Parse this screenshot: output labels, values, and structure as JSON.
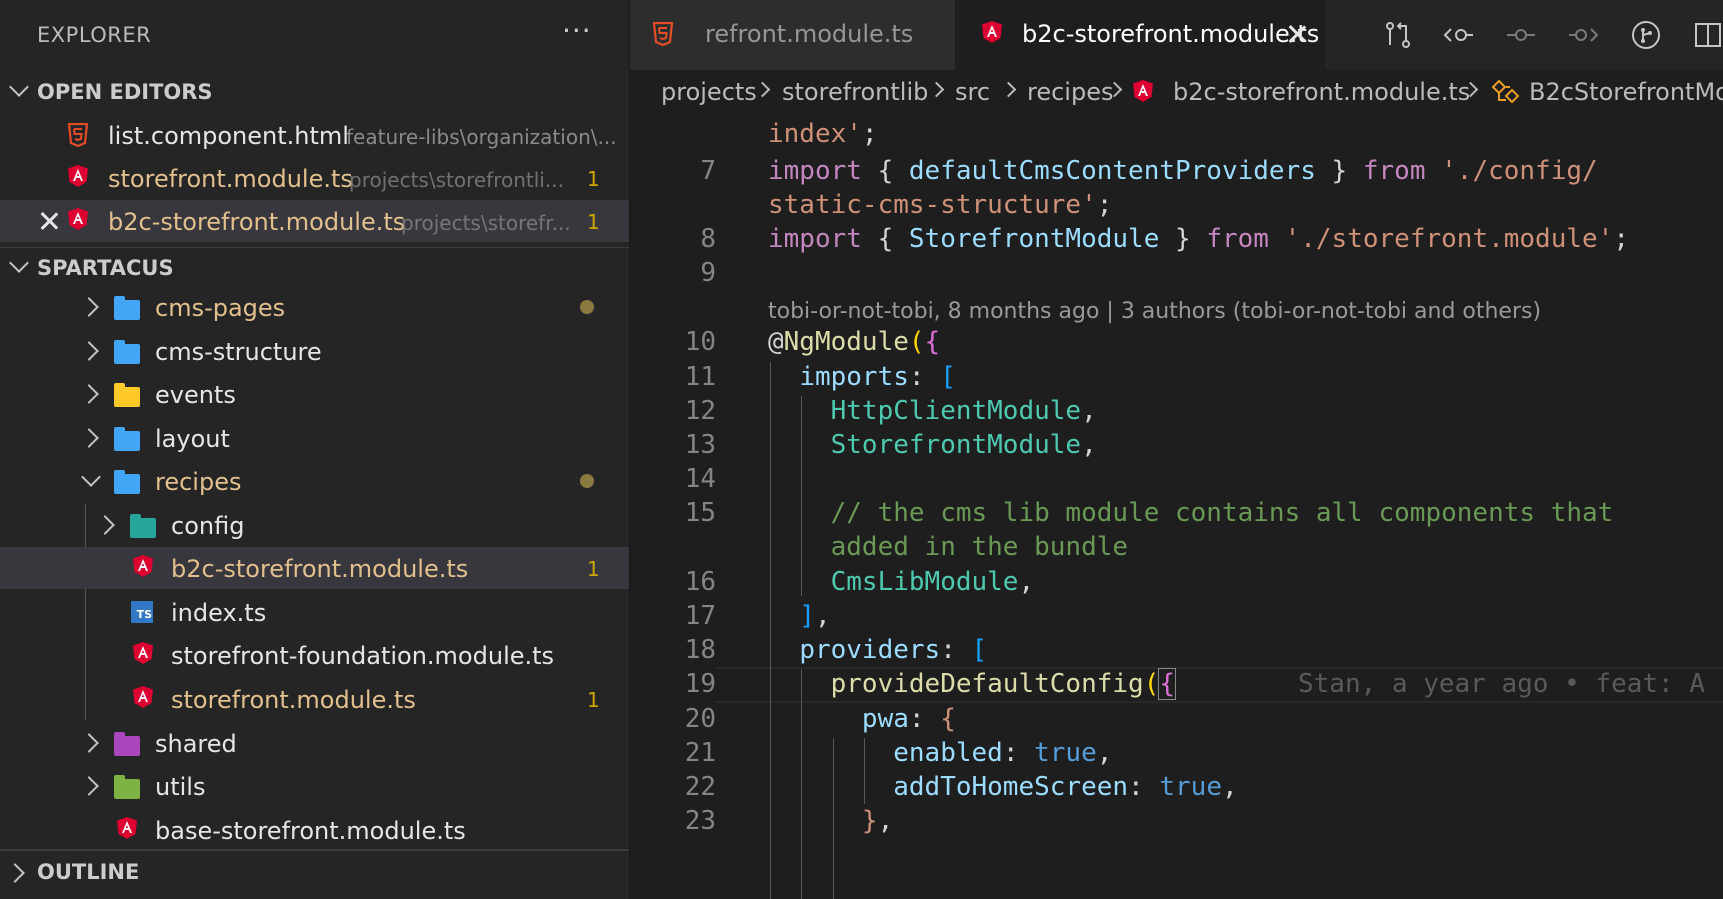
{
  "explorer": {
    "title": "EXPLORER",
    "more_icon": "ellipsis-icon",
    "open_editors": {
      "title": "OPEN EDITORS",
      "items": [
        {
          "name": "list.component.html",
          "desc": "feature-libs\\organization\\...",
          "icon": "html5-icon",
          "count": ""
        },
        {
          "name": "storefront.module.ts",
          "desc": "projects\\storefrontli...",
          "icon": "angular-icon",
          "count": "1"
        },
        {
          "name": "b2c-storefront.module.ts",
          "desc": "projects\\storefr...",
          "icon": "angular-icon",
          "count": "1"
        }
      ]
    },
    "workspace": {
      "title": "SPARTACUS",
      "items": [
        {
          "name": "cms-pages"
        },
        {
          "name": "cms-structure"
        },
        {
          "name": "events"
        },
        {
          "name": "layout"
        },
        {
          "name": "recipes"
        },
        {
          "name": "config"
        },
        {
          "name": "b2c-storefront.module.ts",
          "count": "1"
        },
        {
          "name": "index.ts",
          "icon_text": "TS"
        },
        {
          "name": "storefront-foundation.module.ts"
        },
        {
          "name": "storefront.module.ts",
          "count": "1"
        },
        {
          "name": "shared"
        },
        {
          "name": "utils"
        },
        {
          "name": "base-storefront.module.ts"
        }
      ]
    },
    "outline": {
      "title": "OUTLINE"
    }
  },
  "tabs": [
    {
      "label": "refront.module.ts",
      "icon": "html5-icon",
      "active": false
    },
    {
      "label": "b2c-storefront.module.ts",
      "icon": "angular-icon",
      "active": true
    }
  ],
  "toolbar": [
    "compare-changes-icon",
    "previous-change-icon",
    "commit-icon",
    "next-change-icon",
    "git-graph-icon",
    "split-editor-icon"
  ],
  "breadcrumb": [
    "projects",
    "storefrontlib",
    "src",
    "recipes",
    "b2c-storefront.module.ts",
    "B2cStorefrontMo"
  ],
  "editor": {
    "codelens": "tobi-or-not-tobi, 8 months ago | 3 authors (tobi-or-not-tobi and others)",
    "blame": "Stan, a year ago • feat: A",
    "line_numbers": [
      "7",
      "8",
      "9",
      "10",
      "11",
      "12",
      "13",
      "14",
      "15",
      "16",
      "17",
      "18",
      "19",
      "20",
      "21",
      "22",
      "23"
    ]
  },
  "colors": {
    "angular": "#dd0031",
    "html5": "#e44d26",
    "folder_blue": "#42a5f5",
    "modified_yellow": "#cca700",
    "selected_row": "#37373d"
  }
}
